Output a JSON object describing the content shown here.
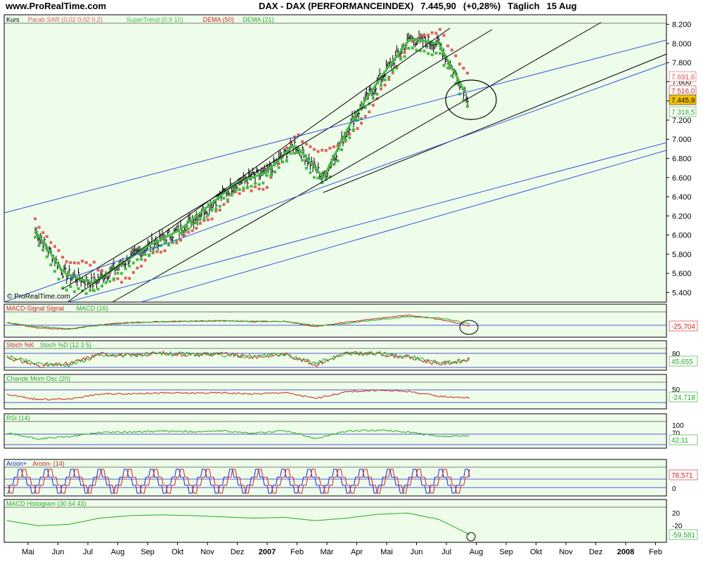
{
  "header": {
    "site": "www.ProRealTime.com",
    "symbol": "DAX - DAX (PERFORMANCEINDEX)",
    "last": "7.445,90",
    "change": "(+0,28%)",
    "period": "Täglich",
    "date": "15 Aug"
  },
  "colors": {
    "panel_bg": "#eefcea",
    "price_bar": "#000000",
    "sar": "#e06060",
    "supertrend": "#44bb44",
    "dema": "#cc2222",
    "channel": "#000000",
    "trendline": "#3355dd",
    "green": "#22aa22",
    "red": "#cc2222",
    "blue": "#2222cc"
  },
  "watermark": "© ProRealTime.com",
  "chart_data": [
    {
      "type": "line",
      "panel": "Kurs",
      "legend": [
        "Kurs",
        "Parab SAR (0,02 0,02 0,2)",
        "SuperTrend (0,9 10)",
        "DEMA (50)",
        "DEMA (21)"
      ],
      "ylim": [
        5300,
        8300
      ],
      "yticks": [
        "5.400",
        "5.600",
        "5.800",
        "6.000",
        "6.200",
        "6.400",
        "6.600",
        "6.800",
        "7.000",
        "7.200",
        "7.400",
        "7.600",
        "7.800",
        "8.000",
        "8.200"
      ],
      "yticks_values": [
        5400,
        5600,
        5800,
        6000,
        6200,
        6400,
        6600,
        6800,
        7000,
        7200,
        7400,
        7600,
        7800,
        8000,
        8200
      ],
      "x": [
        "Mai",
        "Jun",
        "Jul",
        "Aug",
        "Sep",
        "Okt",
        "Nov",
        "Dez",
        "Jan 07",
        "Feb",
        "Mär",
        "Apr",
        "Mai",
        "Jun",
        "Jul",
        "Aug"
      ],
      "series": [
        {
          "name": "Kurs",
          "values": [
            6050,
            5600,
            5500,
            5700,
            5900,
            6050,
            6300,
            6550,
            6650,
            6950,
            6600,
            7200,
            7650,
            8050,
            8000,
            7446
          ]
        },
        {
          "name": "Parab SAR (0,02 0,02 0,2)",
          "values": [
            6150,
            5750,
            5700,
            5500,
            5780,
            5950,
            6150,
            6450,
            6500,
            7050,
            6850,
            7050,
            7500,
            8000,
            8150,
            7690
          ]
        },
        {
          "name": "SuperTrend (0,9 10)",
          "values": [
            5950,
            5450,
            5400,
            5600,
            5820,
            5980,
            6220,
            6480,
            6580,
            6880,
            6500,
            7100,
            7550,
            7950,
            7900,
            7320
          ]
        }
      ],
      "value_tags": [
        "7.691,6",
        "7.516,0",
        "7.445,9",
        "7.318,5"
      ],
      "last_value_label": "7.445,9"
    },
    {
      "type": "line",
      "panel": "MACD",
      "legend": [
        "MACD-Signal Signal",
        "MACD (16)"
      ],
      "last_value_label": "-25,704",
      "series": [
        {
          "name": "MACD (16)",
          "values": [
            20,
            -60,
            -80,
            -10,
            30,
            40,
            50,
            55,
            40,
            45,
            -40,
            30,
            90,
            140,
            80,
            -26
          ]
        },
        {
          "name": "MACD-Signal Signal",
          "values": [
            25,
            -40,
            -70,
            -20,
            20,
            35,
            45,
            50,
            45,
            40,
            -20,
            10,
            70,
            120,
            100,
            10
          ]
        }
      ]
    },
    {
      "type": "line",
      "panel": "Stochastik",
      "legend": [
        "Stoch %K",
        "Stoch %D (12 3 5)"
      ],
      "yticks": [
        "80"
      ],
      "last_value_label": "45,655",
      "series": [
        {
          "name": "Stoch %K",
          "values": [
            60,
            10,
            20,
            80,
            70,
            85,
            75,
            80,
            60,
            80,
            15,
            85,
            80,
            60,
            20,
            46
          ]
        },
        {
          "name": "Stoch %D (12 3 5)",
          "values": [
            65,
            20,
            15,
            70,
            75,
            80,
            78,
            75,
            65,
            78,
            25,
            80,
            85,
            65,
            30,
            40
          ]
        }
      ]
    },
    {
      "type": "line",
      "panel": "Chande",
      "legend": [
        "Chande Mom Osc (20)"
      ],
      "yticks": [
        "50"
      ],
      "last_value_label": "-24,718",
      "series": [
        {
          "name": "Chande Mom Osc (20)",
          "values": [
            5,
            -40,
            -35,
            10,
            15,
            20,
            18,
            22,
            10,
            25,
            -30,
            30,
            45,
            35,
            -10,
            -25
          ]
        }
      ]
    },
    {
      "type": "line",
      "panel": "RSI",
      "legend": [
        "RSI (14)"
      ],
      "yticks": [
        "100",
        "70"
      ],
      "last_value_label": "42,11",
      "series": [
        {
          "name": "RSI (14)",
          "values": [
            55,
            30,
            40,
            60,
            62,
            65,
            63,
            66,
            55,
            68,
            32,
            65,
            70,
            62,
            40,
            42
          ]
        }
      ]
    },
    {
      "type": "line",
      "panel": "Aroon",
      "legend": [
        "Aroon+",
        "Aroon- (14)"
      ],
      "yticks": [
        "0"
      ],
      "last_value_label": "78,571",
      "series": [
        {
          "name": "Aroon+",
          "values": [
            100,
            0,
            100,
            0,
            100,
            0,
            100,
            0,
            100,
            0,
            100,
            0,
            100,
            0,
            100,
            0
          ]
        },
        {
          "name": "Aroon- (14)",
          "values": [
            0,
            100,
            0,
            100,
            0,
            100,
            0,
            100,
            0,
            100,
            0,
            100,
            0,
            100,
            0,
            79
          ]
        }
      ]
    },
    {
      "type": "line",
      "panel": "MACD Histogram",
      "legend": [
        "MACD Histogram (30 64 43)"
      ],
      "yticks": [
        "20",
        "-20"
      ],
      "last_value_label": "-59,581",
      "series": [
        {
          "name": "MACD Histogram (30 64 43)",
          "values": [
            -5,
            -25,
            -20,
            5,
            15,
            18,
            15,
            10,
            5,
            8,
            -5,
            5,
            20,
            25,
            0,
            -60
          ]
        }
      ]
    }
  ],
  "x_axis": {
    "labels": [
      "Mai",
      "Jun",
      "Jul",
      "Aug",
      "Sep",
      "Okt",
      "Nov",
      "Dez",
      "2007",
      "Feb",
      "Mär",
      "Apr",
      "Mai",
      "Jun",
      "Jul",
      "Aug",
      "Sep",
      "Okt",
      "Nov",
      "Dez",
      "2008",
      "Feb"
    ],
    "bold": [
      false,
      false,
      false,
      false,
      false,
      false,
      false,
      false,
      true,
      false,
      false,
      false,
      false,
      false,
      false,
      false,
      false,
      false,
      false,
      false,
      true,
      false
    ]
  }
}
